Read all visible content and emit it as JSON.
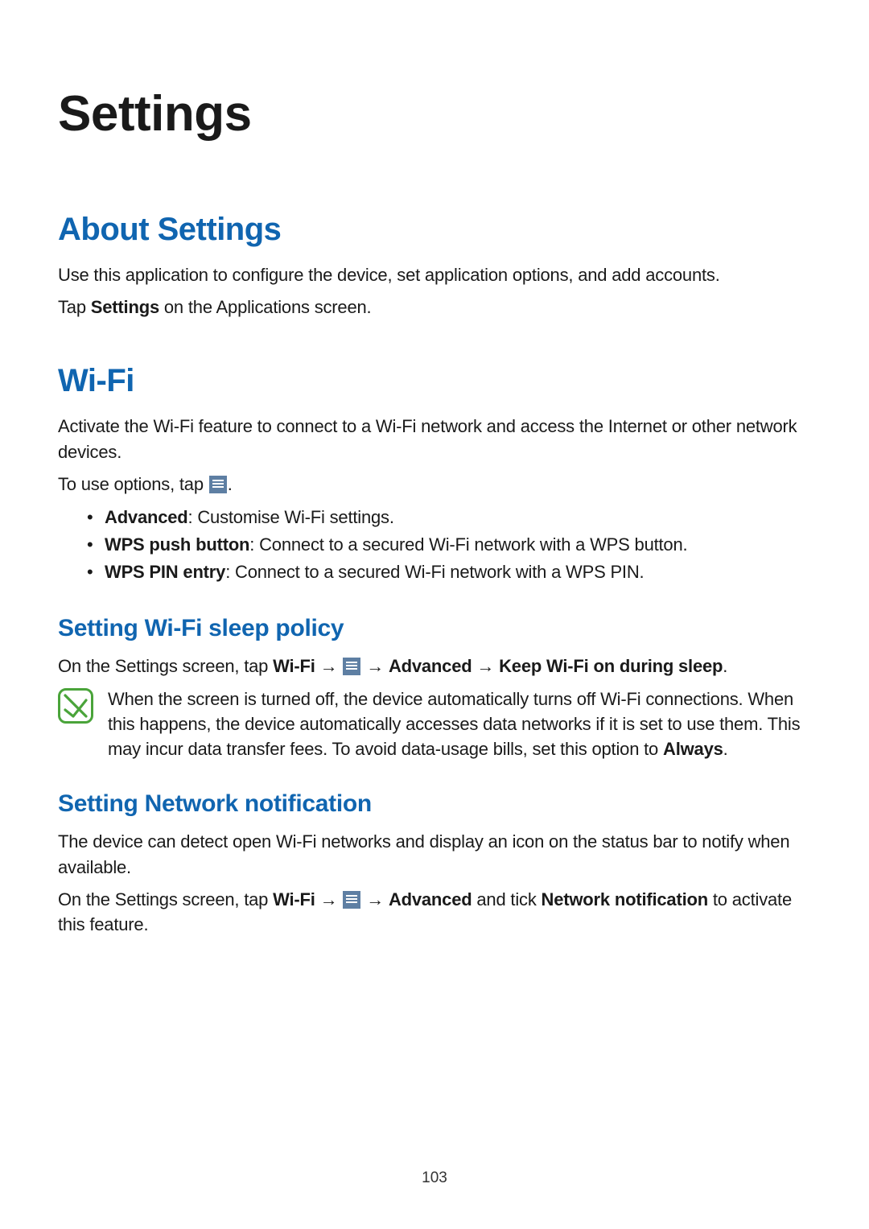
{
  "chapter": {
    "title": "Settings"
  },
  "s1": {
    "heading": "About Settings",
    "p1": "Use this application to configure the device, set application options, and add accounts.",
    "p2_a": "Tap ",
    "p2_b": "Settings",
    "p2_c": " on the Applications screen."
  },
  "s2": {
    "heading": "Wi-Fi",
    "p1": "Activate the Wi-Fi feature to connect to a Wi-Fi network and access the Internet or other network devices.",
    "p2_a": "To use options, tap ",
    "p2_b": ".",
    "bullets": [
      {
        "b": "Advanced",
        "rest": ": Customise Wi-Fi settings."
      },
      {
        "b": "WPS push button",
        "rest": ": Connect to a secured Wi-Fi network with a WPS button."
      },
      {
        "b": "WPS PIN entry",
        "rest": ": Connect to a secured Wi-Fi network with a WPS PIN."
      }
    ]
  },
  "s3": {
    "heading": "Setting Wi-Fi sleep policy",
    "p1_a": "On the Settings screen, tap ",
    "p1_b": "Wi-Fi",
    "p1_arrow1": " → ",
    "p1_arrow2": " → ",
    "p1_c": "Advanced",
    "p1_arrow3": " → ",
    "p1_d": "Keep Wi-Fi on during sleep",
    "p1_e": ".",
    "note_a": "When the screen is turned off, the device automatically turns off Wi-Fi connections. When this happens, the device automatically accesses data networks if it is set to use them. This may incur data transfer fees. To avoid data-usage bills, set this option to ",
    "note_b": "Always",
    "note_c": "."
  },
  "s4": {
    "heading": "Setting Network notification",
    "p1": "The device can detect open Wi-Fi networks and display an icon on the status bar to notify when available.",
    "p2_a": "On the Settings screen, tap ",
    "p2_b": "Wi-Fi",
    "p2_arrow1": " → ",
    "p2_arrow2": " → ",
    "p2_c": "Advanced",
    "p2_d": " and tick ",
    "p2_e": "Network notification",
    "p2_f": " to activate this feature."
  },
  "pagenum": "103"
}
